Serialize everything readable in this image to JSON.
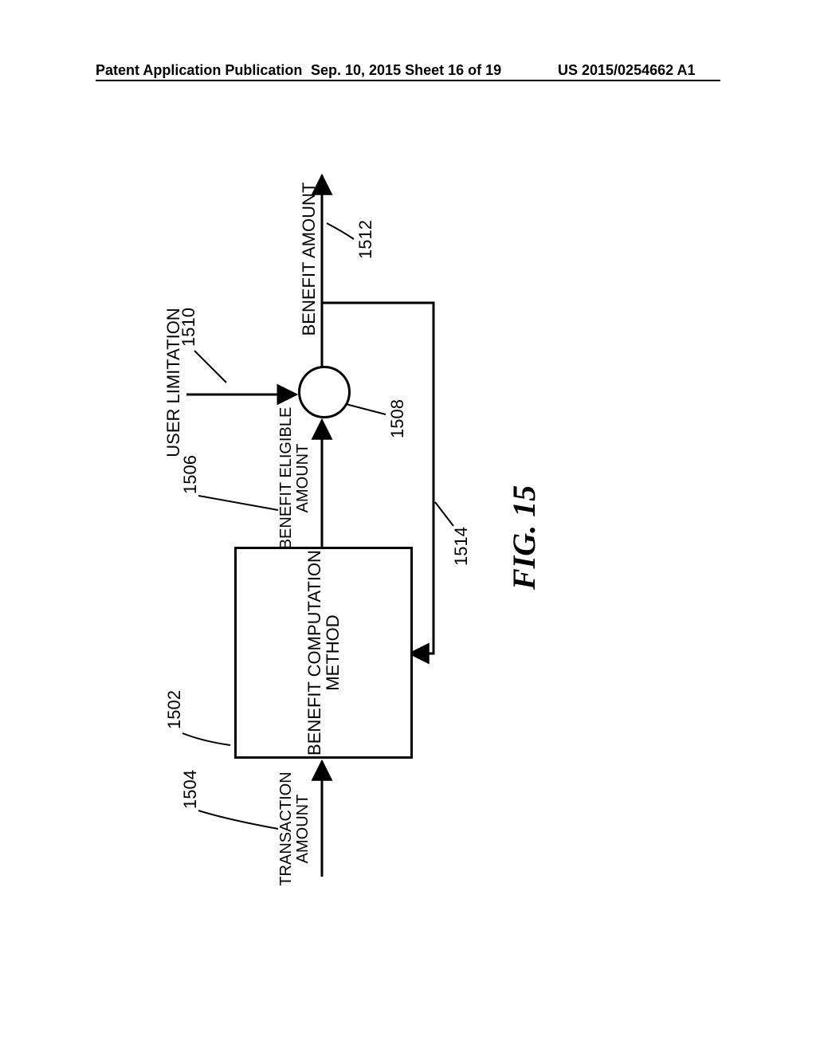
{
  "header": {
    "left": "Patent Application Publication",
    "center": "Sep. 10, 2015  Sheet 16 of 19",
    "right": "US 2015/0254662 A1"
  },
  "diagram": {
    "box_label": "BENEFIT COMPUTATION METHOD",
    "transaction_label": "TRANSACTION\nAMOUNT",
    "eligible_label": "BENEFIT ELIGIBLE\nAMOUNT",
    "user_limitation_label": "USER LIMITATION",
    "benefit_amount_label": "BENEFIT AMOUNT",
    "ref_1502": "1502",
    "ref_1504": "1504",
    "ref_1506": "1506",
    "ref_1508": "1508",
    "ref_1510": "1510",
    "ref_1512": "1512",
    "ref_1514": "1514"
  },
  "figure_caption": "FIG. 15"
}
